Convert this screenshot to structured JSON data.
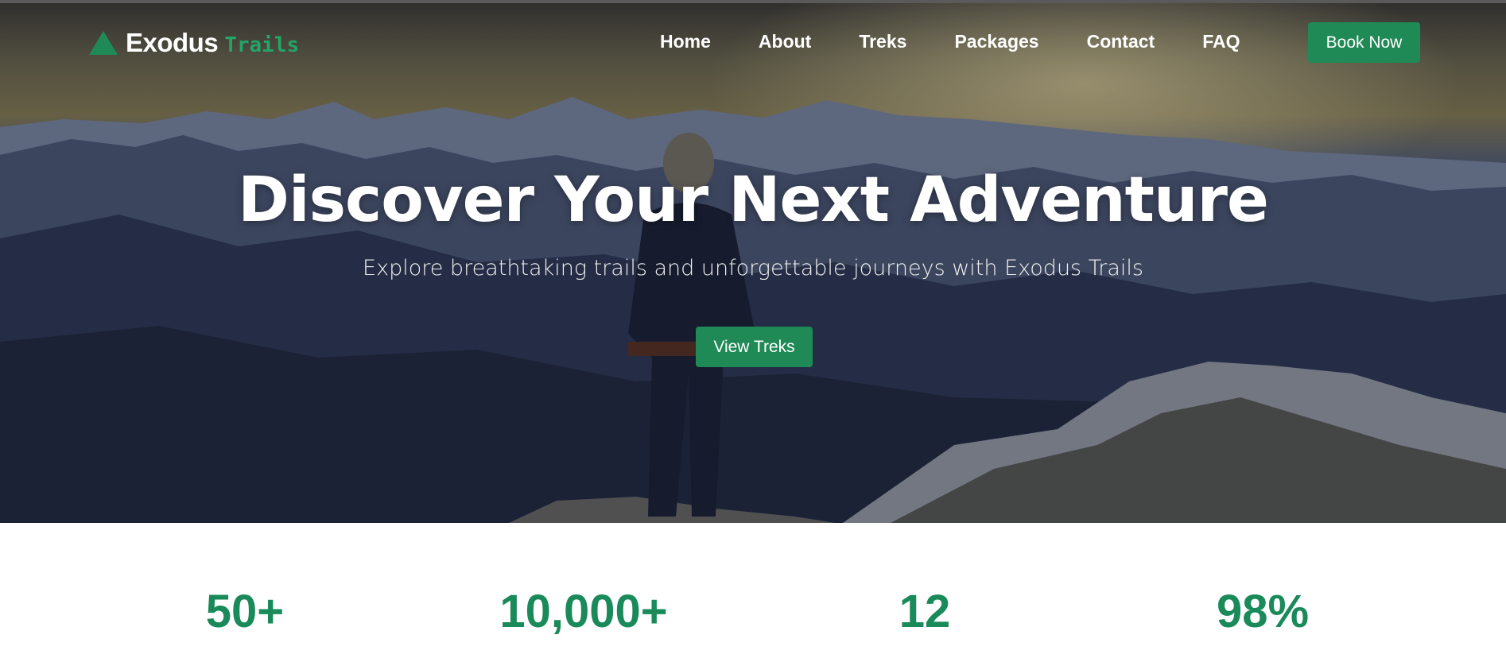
{
  "brand": {
    "name": "Exodus",
    "suffix": "Trails",
    "icon": "mountain-icon",
    "accent_color": "#22a566"
  },
  "nav": {
    "links": [
      "Home",
      "About",
      "Treks",
      "Packages",
      "Contact",
      "FAQ"
    ],
    "cta_label": "Book Now"
  },
  "hero": {
    "title": "Discover Your Next Adventure",
    "subtitle": "Explore breathtaking trails and unforgettable journeys with Exodus Trails",
    "cta_label": "View Treks",
    "button_color": "#1f8a55"
  },
  "stats": [
    "50+",
    "10,000+",
    "12",
    "98%"
  ],
  "stat_color": "#1a8a5a"
}
